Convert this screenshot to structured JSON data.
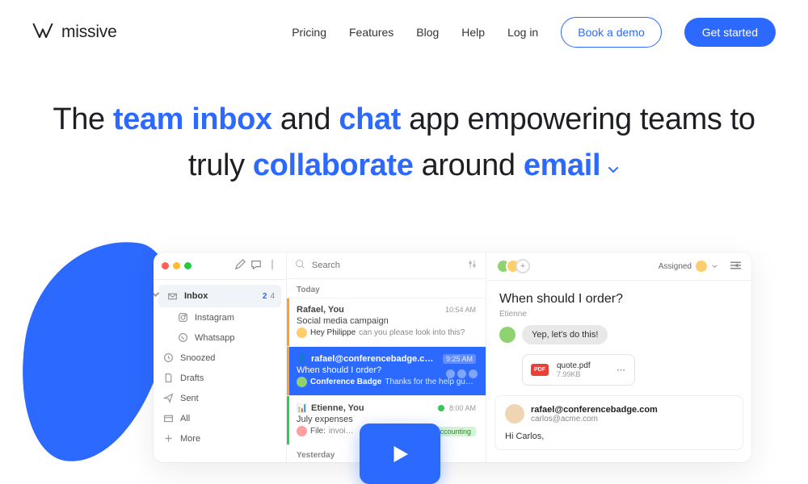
{
  "header": {
    "brand": "missive",
    "nav": [
      "Pricing",
      "Features",
      "Blog",
      "Help",
      "Log in"
    ],
    "demo_btn": "Book a demo",
    "start_btn": "Get started"
  },
  "headline": {
    "part1": "The ",
    "accent1": "team inbox",
    "part2": " and ",
    "accent2": "chat",
    "part3": " app empowering teams to truly ",
    "accent3": "collaborate",
    "part4": " around ",
    "accent4": "email"
  },
  "app": {
    "search_placeholder": "Search",
    "section_today": "Today",
    "section_yesterday": "Yesterday",
    "sidebar": [
      {
        "label": "Inbox",
        "badge1": "2",
        "badge2": "4"
      },
      {
        "label": "Instagram"
      },
      {
        "label": "Whatsapp"
      },
      {
        "label": "Snoozed"
      },
      {
        "label": "Drafts"
      },
      {
        "label": "Sent"
      },
      {
        "label": "All"
      },
      {
        "label": "More"
      }
    ],
    "convs": [
      {
        "from": "Rafael, You",
        "time": "10:54 AM",
        "subject": "Social media campaign",
        "snippet_prefix": "Hey Philippe ",
        "snippet": "can you please look into this?"
      },
      {
        "from": "rafael@conferencebadge.com, carl…",
        "time": "9:25 AM",
        "subject": "When should I order?",
        "snippet_prefix": "Conference Badge ",
        "snippet": "Thanks for the help gu…"
      },
      {
        "from": "Etienne, You",
        "time": "8:00 AM",
        "subject": "July expenses",
        "snippet_prefix": "File: ",
        "snippet": "invoi…",
        "tag": "Accounting"
      }
    ],
    "main": {
      "assigned_label": "Assigned",
      "subject": "When should I order?",
      "from_label": "Etienne",
      "bubble": "Yep, let's do this!",
      "attachment": {
        "name": "quote.pdf",
        "size": "7.99KB",
        "type": "PDF"
      },
      "email_from": "rafael@conferencebadge.com",
      "email_to": "carlos@acme.com",
      "greeting": "Hi Carlos,"
    }
  }
}
